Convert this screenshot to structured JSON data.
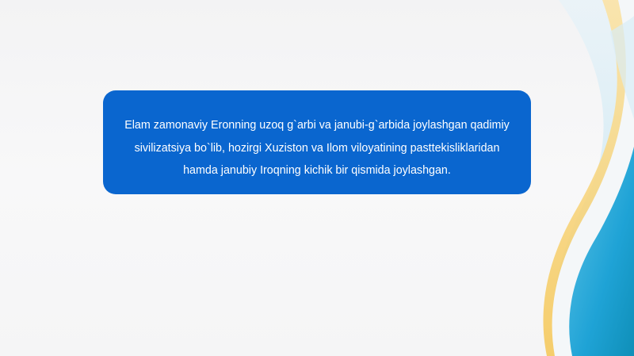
{
  "slide": {
    "text": "Elam zamonaviy Eronning uzoq g`arbi va janubi-g`arbida joylashgan qadimiy sivilizatsiya bo`lib, hozirgi Xuziston va Ilom viloyatining pasttekisliklaridan hamda janubiy Iroqning kichik bir qismida joylashgan."
  },
  "colors": {
    "text_box_background": "#0a66cf",
    "text_color": "#ffffff",
    "page_background": "#f6f6f7",
    "wave_yellow": "#f7d27a",
    "wave_light_blue": "#bfe3f2",
    "wave_blue": "#1fa3d6",
    "wave_teal": "#0f8fb8"
  }
}
